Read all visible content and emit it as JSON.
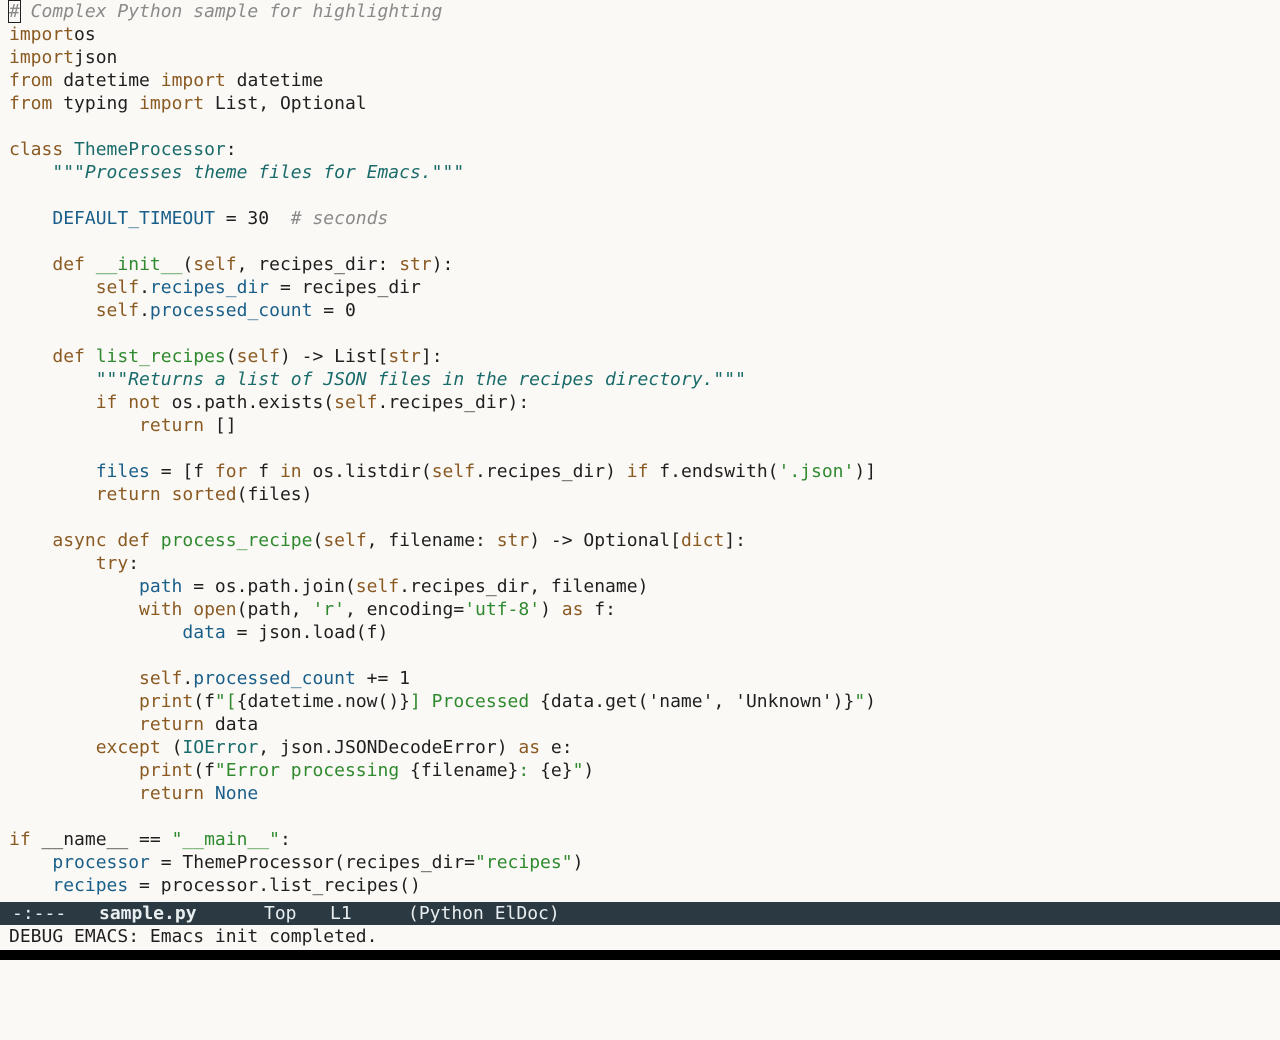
{
  "buffer": {
    "lines": [
      [
        [
          "cm",
          "# Complex Python sample for highlighting"
        ]
      ],
      [
        [
          "kw",
          "import"
        ],
        [
          "",
          "os"
        ]
      ],
      [
        [
          "kw",
          "import"
        ],
        [
          "",
          "json"
        ]
      ],
      [
        [
          "kw",
          "from"
        ],
        [
          "",
          " datetime "
        ],
        [
          "kw",
          "import"
        ],
        [
          "",
          " datetime"
        ]
      ],
      [
        [
          "kw",
          "from"
        ],
        [
          "",
          " typing "
        ],
        [
          "kw",
          "import"
        ],
        [
          "",
          " List, Optional"
        ]
      ],
      [],
      [
        [
          "kw",
          "class"
        ],
        [
          "",
          " "
        ],
        [
          "ty",
          "ThemeProcessor"
        ],
        [
          "",
          ":"
        ]
      ],
      [
        [
          "",
          "    "
        ],
        [
          "doc",
          "\"\"\"Processes theme files for Emacs.\"\"\""
        ]
      ],
      [],
      [
        [
          "",
          "    "
        ],
        [
          "vr",
          "DEFAULT_TIMEOUT"
        ],
        [
          "",
          " = 30  "
        ],
        [
          "cm",
          "# seconds"
        ]
      ],
      [],
      [
        [
          "",
          "    "
        ],
        [
          "kw",
          "def"
        ],
        [
          "",
          " "
        ],
        [
          "fn",
          "__init__"
        ],
        [
          "",
          "("
        ],
        [
          "kw",
          "self"
        ],
        [
          "",
          ", recipes_dir: "
        ],
        [
          "kw",
          "str"
        ],
        [
          "",
          "):"
        ]
      ],
      [
        [
          "",
          "        "
        ],
        [
          "kw",
          "self"
        ],
        [
          "",
          "."
        ],
        [
          "vr",
          "recipes_dir"
        ],
        [
          "",
          " = recipes_dir"
        ]
      ],
      [
        [
          "",
          "        "
        ],
        [
          "kw",
          "self"
        ],
        [
          "",
          "."
        ],
        [
          "vr",
          "processed_count"
        ],
        [
          "",
          " = 0"
        ]
      ],
      [],
      [
        [
          "",
          "    "
        ],
        [
          "kw",
          "def"
        ],
        [
          "",
          " "
        ],
        [
          "fn",
          "list_recipes"
        ],
        [
          "",
          "("
        ],
        [
          "kw",
          "self"
        ],
        [
          "",
          ") -> List["
        ],
        [
          "kw",
          "str"
        ],
        [
          "",
          "]:"
        ]
      ],
      [
        [
          "",
          "        "
        ],
        [
          "doc",
          "\"\"\"Returns a list of JSON files in the recipes directory.\"\"\""
        ]
      ],
      [
        [
          "",
          "        "
        ],
        [
          "kw",
          "if"
        ],
        [
          "",
          " "
        ],
        [
          "kw",
          "not"
        ],
        [
          "",
          " os.path.exists("
        ],
        [
          "kw",
          "self"
        ],
        [
          "",
          ".recipes_dir):"
        ]
      ],
      [
        [
          "",
          "            "
        ],
        [
          "kw",
          "return"
        ],
        [
          "",
          " []"
        ]
      ],
      [],
      [
        [
          "",
          "        "
        ],
        [
          "vr",
          "files"
        ],
        [
          "",
          " = [f "
        ],
        [
          "kw",
          "for"
        ],
        [
          "",
          " f "
        ],
        [
          "kw",
          "in"
        ],
        [
          "",
          " os.listdir("
        ],
        [
          "kw",
          "self"
        ],
        [
          "",
          ".recipes_dir) "
        ],
        [
          "kw",
          "if"
        ],
        [
          "",
          " f.endswith("
        ],
        [
          "st",
          "'.json'"
        ],
        [
          "",
          ")]"
        ]
      ],
      [
        [
          "",
          "        "
        ],
        [
          "kw",
          "return"
        ],
        [
          "",
          " "
        ],
        [
          "kw",
          "sorted"
        ],
        [
          "",
          "(files)"
        ]
      ],
      [],
      [
        [
          "",
          "    "
        ],
        [
          "kw",
          "async"
        ],
        [
          "",
          " "
        ],
        [
          "kw",
          "def"
        ],
        [
          "",
          " "
        ],
        [
          "fn",
          "process_recipe"
        ],
        [
          "",
          "("
        ],
        [
          "kw",
          "self"
        ],
        [
          "",
          ", filename: "
        ],
        [
          "kw",
          "str"
        ],
        [
          "",
          ") -> Optional["
        ],
        [
          "kw",
          "dict"
        ],
        [
          "",
          "]:"
        ]
      ],
      [
        [
          "",
          "        "
        ],
        [
          "kw",
          "try"
        ],
        [
          "",
          ":"
        ]
      ],
      [
        [
          "",
          "            "
        ],
        [
          "vr",
          "path"
        ],
        [
          "",
          " = os.path.join("
        ],
        [
          "kw",
          "self"
        ],
        [
          "",
          ".recipes_dir, filename)"
        ]
      ],
      [
        [
          "",
          "            "
        ],
        [
          "kw",
          "with"
        ],
        [
          "",
          " "
        ],
        [
          "kw",
          "open"
        ],
        [
          "",
          "(path, "
        ],
        [
          "st",
          "'r'"
        ],
        [
          "",
          ", encoding="
        ],
        [
          "st",
          "'utf-8'"
        ],
        [
          "",
          ") "
        ],
        [
          "kw",
          "as"
        ],
        [
          "",
          " f:"
        ]
      ],
      [
        [
          "",
          "                "
        ],
        [
          "vr",
          "data"
        ],
        [
          "",
          " = json.load(f)"
        ]
      ],
      [],
      [
        [
          "",
          "            "
        ],
        [
          "kw",
          "self"
        ],
        [
          "",
          "."
        ],
        [
          "vr",
          "processed_count"
        ],
        [
          "",
          " += 1"
        ]
      ],
      [
        [
          "",
          "            "
        ],
        [
          "kw",
          "print"
        ],
        [
          "",
          "(f"
        ],
        [
          "st",
          "\"["
        ],
        [
          "",
          "{datetime.now()}"
        ],
        [
          "st",
          "] Processed "
        ],
        [
          "",
          "{data.get('name', 'Unknown')}"
        ],
        [
          "st",
          "\""
        ],
        [
          "",
          ")"
        ]
      ],
      [
        [
          "",
          "            "
        ],
        [
          "kw",
          "return"
        ],
        [
          "",
          " data"
        ]
      ],
      [
        [
          "",
          "        "
        ],
        [
          "kw",
          "except"
        ],
        [
          "",
          " ("
        ],
        [
          "ty",
          "IOError"
        ],
        [
          "",
          ", json.JSONDecodeError) "
        ],
        [
          "kw",
          "as"
        ],
        [
          "",
          " e:"
        ]
      ],
      [
        [
          "",
          "            "
        ],
        [
          "kw",
          "print"
        ],
        [
          "",
          "(f"
        ],
        [
          "st",
          "\"Error processing "
        ],
        [
          "",
          "{filename}"
        ],
        [
          "st",
          ": "
        ],
        [
          "",
          "{e}"
        ],
        [
          "st",
          "\""
        ],
        [
          "",
          ")"
        ]
      ],
      [
        [
          "",
          "            "
        ],
        [
          "kw",
          "return"
        ],
        [
          "",
          " "
        ],
        [
          "bl",
          "None"
        ]
      ],
      [],
      [
        [
          "kw",
          "if"
        ],
        [
          "",
          " __name__ == "
        ],
        [
          "st",
          "\"__main__\""
        ],
        [
          "",
          ":"
        ]
      ],
      [
        [
          "",
          "    "
        ],
        [
          "vr",
          "processor"
        ],
        [
          "",
          " = ThemeProcessor(recipes_dir="
        ],
        [
          "st",
          "\"recipes\""
        ],
        [
          "",
          ")"
        ]
      ],
      [
        [
          "",
          "    "
        ],
        [
          "vr",
          "recipes"
        ],
        [
          "",
          " = processor.list_recipes()"
        ]
      ]
    ]
  },
  "modeline": {
    "status": "-:---",
    "buffer_name": "sample.py",
    "position": "Top",
    "line": "L1",
    "modes": "(Python ElDoc)"
  },
  "echo_area": {
    "message": "DEBUG EMACS: Emacs init completed."
  },
  "colors": {
    "keyword": "#8a5a23",
    "type": "#1a6b6b",
    "function": "#2f8a2f",
    "variable": "#1a5f8a",
    "comment": "#8a8a8a",
    "string": "#2f8a2f",
    "modeline_bg": "#2b3a42"
  }
}
